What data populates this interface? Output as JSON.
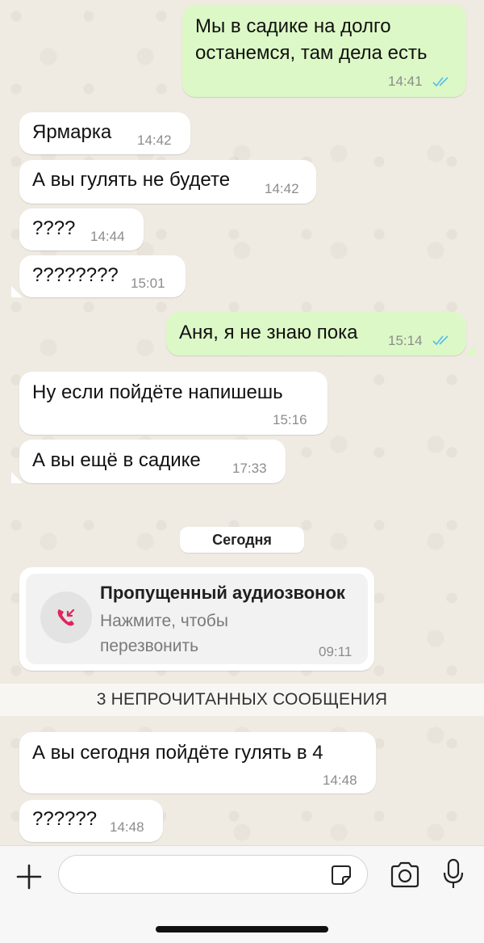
{
  "messages": [
    {
      "direction": "out",
      "text": "Мы в садике на долго\nостанемся, там дела есть",
      "time": "14:41",
      "read": true
    },
    {
      "direction": "in",
      "text": "Ярмарка",
      "time": "14:42"
    },
    {
      "direction": "in",
      "text": "А вы гулять не будете",
      "time": "14:42"
    },
    {
      "direction": "in",
      "text": "????",
      "time": "14:44"
    },
    {
      "direction": "in",
      "text": "????????",
      "time": "15:01"
    },
    {
      "direction": "out",
      "text": "Аня, я не знаю пока",
      "time": "15:14",
      "read": true
    },
    {
      "direction": "in",
      "text": "Ну если пойдёте напишешь",
      "time": "15:16"
    },
    {
      "direction": "in",
      "text": "А вы ещё в садике",
      "time": "17:33"
    }
  ],
  "date_separator": "Сегодня",
  "missed_call": {
    "title": "Пропущенный аудиозвонок",
    "subtitle": "Нажмите, чтобы\nперезвонить",
    "time": "09:11",
    "icon": "missed-call-icon"
  },
  "unread_banner": "3 НЕПРОЧИТАННЫХ СООБЩЕНИЯ",
  "new_messages": [
    {
      "direction": "in",
      "text": "А вы сегодня пойдёте гулять в 4",
      "time": "14:48"
    },
    {
      "direction": "in",
      "text": "??????",
      "time": "14:48"
    }
  ],
  "input_bar": {
    "placeholder": "",
    "icons": [
      "plus-icon",
      "sticker-icon",
      "camera-icon",
      "microphone-icon"
    ]
  },
  "colors": {
    "outgoing_bubble": "#dcf8c6",
    "incoming_bubble": "#ffffff",
    "background": "#efeae2",
    "read_ticks": "#53bdeb",
    "missed_call_red": "#e0245e"
  }
}
